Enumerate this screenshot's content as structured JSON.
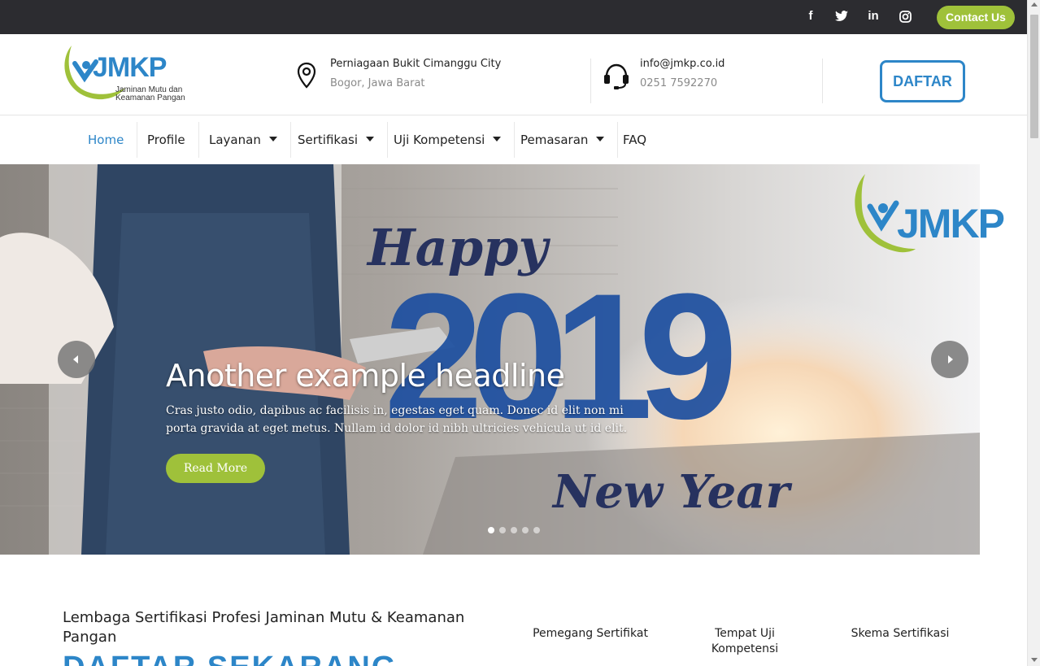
{
  "topbar": {
    "social": [
      {
        "icon": "facebook-icon",
        "glyph": "f"
      },
      {
        "icon": "twitter-icon",
        "glyph": "t"
      },
      {
        "icon": "linkedin-icon",
        "glyph": "in"
      },
      {
        "icon": "instagram-icon",
        "glyph": "◎"
      }
    ],
    "contact_label": "Contact Us"
  },
  "header": {
    "logo_text": "JMKP",
    "logo_tagline": "Jaminan Mutu dan Keamanan Pangan",
    "address_line1": "Perniagaan Bukit Cimanggu City",
    "address_line2": "Bogor, Jawa Barat",
    "email": "info@jmkp.co.id",
    "phone": "0251 7592270",
    "daftar_label": "DAFTAR"
  },
  "nav": {
    "items": [
      {
        "label": "Home",
        "active": true,
        "dropdown": false
      },
      {
        "label": "Profile",
        "active": false,
        "dropdown": false
      },
      {
        "label": "Layanan",
        "active": false,
        "dropdown": true
      },
      {
        "label": "Sertifikasi",
        "active": false,
        "dropdown": true
      },
      {
        "label": "Uji Kompetensi",
        "active": false,
        "dropdown": true
      },
      {
        "label": "Pemasaran",
        "active": false,
        "dropdown": true
      },
      {
        "label": "FAQ",
        "active": false,
        "dropdown": false
      }
    ]
  },
  "hero": {
    "logo_text": "JMKP",
    "happy": "Happy",
    "year": "2019",
    "new_year": "New Year",
    "headline": "Another example headline",
    "description": "Cras justo odio, dapibus ac facilisis in, egestas eget quam. Donec id elit non mi porta gravida at eget metus. Nullam id dolor id nibh ultricies vehicula ut id elit.",
    "button_label": "Read More",
    "slide_count": 5,
    "active_slide": 1
  },
  "section": {
    "title": "Lembaga Sertifikasi Profesi Jaminan Mutu & Keamanan Pangan",
    "big_text": "DAFTAR SEKARANG",
    "stats": [
      {
        "label": "Pemegang Sertifikat"
      },
      {
        "label": "Tempat Uji Kompetensi"
      },
      {
        "label": "Skema Sertifikasi"
      }
    ]
  },
  "colors": {
    "brand_blue": "#2d86c8",
    "brand_green": "#9fc13a",
    "topbar_bg": "#2c2c30"
  }
}
